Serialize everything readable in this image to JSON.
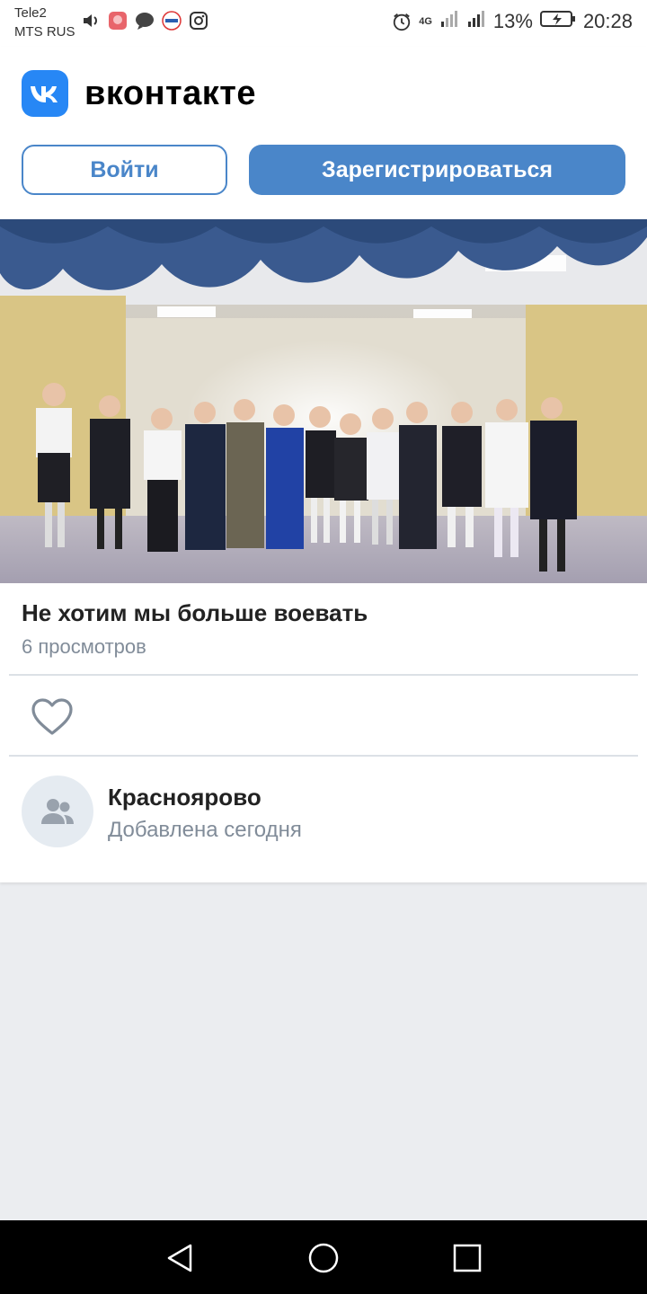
{
  "status_bar": {
    "carrier_1": "Tele2",
    "carrier_2": "MTS RUS",
    "network": "4G",
    "battery": "13%",
    "time": "20:28"
  },
  "header": {
    "brand": "вконтакте",
    "login_label": "Войти",
    "register_label": "Зарегистрироваться",
    "accent_color": "#4a86c9"
  },
  "video": {
    "title": "Не хотим мы больше воевать",
    "views": "6 просмотров"
  },
  "group": {
    "name": "Краснoярово",
    "added": "Добавлена сегодня"
  },
  "icons": {
    "like": "heart-icon",
    "avatar": "group-users-icon",
    "nav": [
      "back-triangle-icon",
      "home-circle-icon",
      "recents-square-icon"
    ]
  }
}
